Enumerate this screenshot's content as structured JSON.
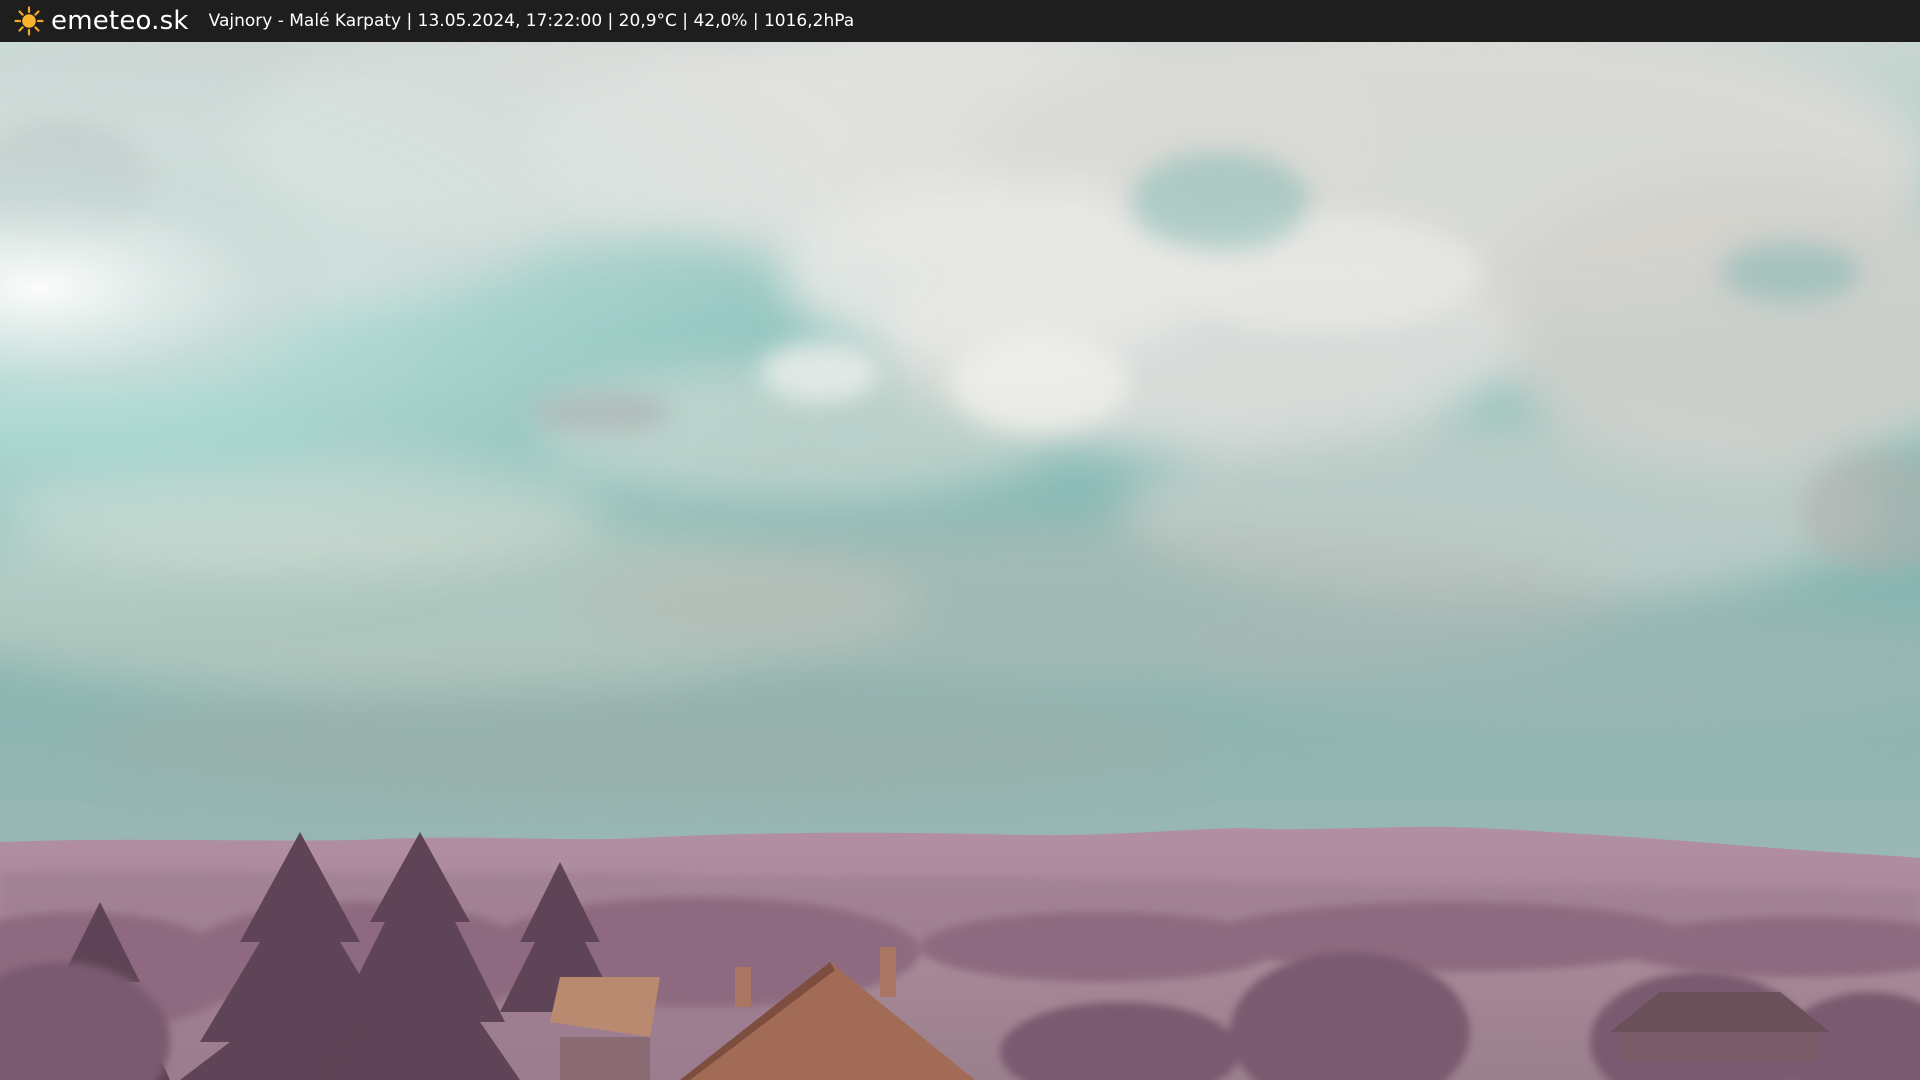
{
  "header": {
    "logo_text": "emeteo.sk",
    "logo_icon": "sun-icon",
    "caption": "Vajnory - Malé Karpaty | 13.05.2024, 17:22:00 | 20,9°C | 42,0% | 1016,2hPa"
  },
  "colors": {
    "bar": "#1e1e1e",
    "sun": "#f5a623",
    "sky_teal": "#7fbcb6",
    "cloud_white": "#e4e4e0",
    "hills": "#a48496",
    "trees": "#6f4f63",
    "roof": "#a06a55"
  }
}
